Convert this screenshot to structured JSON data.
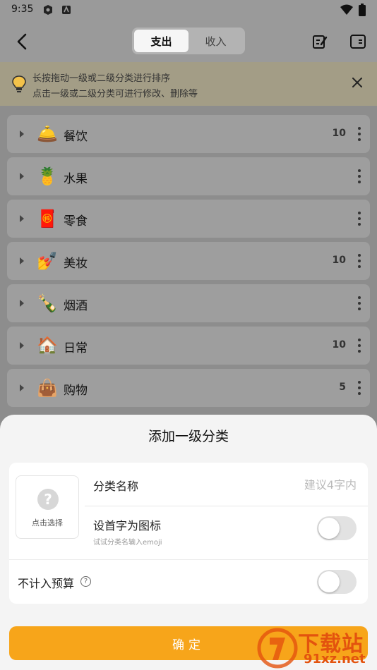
{
  "status_bar": {
    "time": "9:35"
  },
  "header": {
    "tabs": [
      {
        "label": "支出",
        "active": true
      },
      {
        "label": "收入",
        "active": false
      }
    ]
  },
  "tip": {
    "line1": "长按拖动一级或二级分类进行排序",
    "line2": "点击一级或二级分类可进行修改、删除等"
  },
  "categories": [
    {
      "emoji": "🛎️",
      "icon": "cloche-icon",
      "name": "餐饮",
      "count": "10"
    },
    {
      "emoji": "🍍",
      "icon": "fruit-icon",
      "name": "水果",
      "count": ""
    },
    {
      "emoji": "🧧",
      "icon": "snack-bag-icon",
      "name": "零食",
      "count": ""
    },
    {
      "emoji": "💅",
      "icon": "manicure-icon",
      "name": "美妆",
      "count": "10"
    },
    {
      "emoji": "🍾",
      "icon": "bottle-icon",
      "name": "烟酒",
      "count": ""
    },
    {
      "emoji": "🏠",
      "icon": "house-icon",
      "name": "日常",
      "count": "10"
    },
    {
      "emoji": "👜",
      "icon": "shopping-bag-icon",
      "name": "购物",
      "count": "5"
    }
  ],
  "sheet": {
    "title": "添加一级分类",
    "icon_picker_label": "点击选择",
    "name_label": "分类名称",
    "name_value": "",
    "name_placeholder": "建议4字内",
    "first_char_label": "设首字为图标",
    "first_char_hint": "试试分类名输入emoji",
    "first_char_enabled": false,
    "budget_label": "不计入预算",
    "budget_enabled": false,
    "confirm_label": "确定"
  },
  "watermark": {
    "text": "下载站",
    "domain": "91xz.net"
  },
  "colors": {
    "accent": "#f7a51a",
    "sheet_bg": "#f4f4f4",
    "watermark": "#e3530e"
  }
}
